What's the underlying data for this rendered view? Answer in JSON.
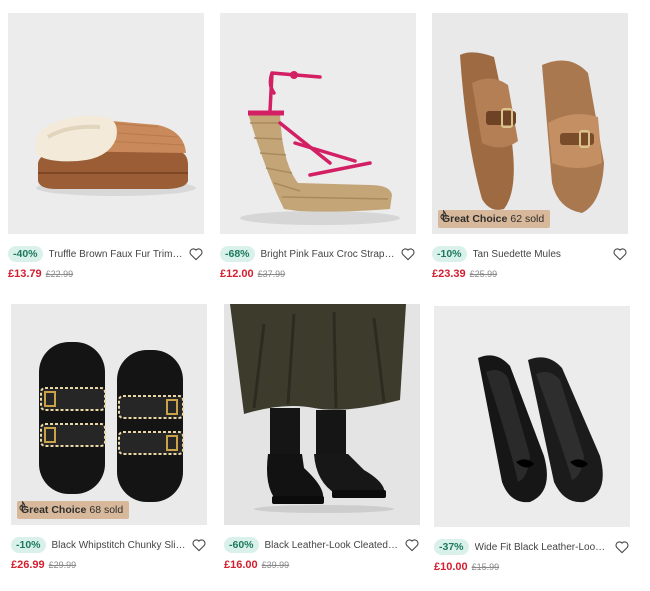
{
  "products": [
    {
      "discount": "-40%",
      "name": "Truffle Brown Faux Fur Trim Sli...",
      "price": "£13.79",
      "was": "£22.99",
      "image": "brown-faux-fur-slippers",
      "badge": null
    },
    {
      "discount": "-68%",
      "name": "Bright Pink Faux Croc Strappy...",
      "price": "£12.00",
      "was": "£37.99",
      "image": "pink-espadrille-wedge",
      "badge": null
    },
    {
      "discount": "-10%",
      "name": "Tan Suedette Mules",
      "price": "£23.39",
      "was": "£25.99",
      "image": "tan-suede-mules",
      "badge": {
        "label": "Great Choice",
        "sold": "62 sold"
      }
    },
    {
      "discount": "-10%",
      "name": "Black Whipstitch Chunky Sliders",
      "price": "£26.99",
      "was": "£29.99",
      "image": "black-whipstitch-sliders",
      "badge": {
        "label": "Great Choice",
        "sold": "68 sold"
      }
    },
    {
      "discount": "-60%",
      "name": "Black Leather-Look Cleated Bl...",
      "price": "£16.00",
      "was": "£39.99",
      "image": "black-chelsea-boots",
      "badge": null
    },
    {
      "discount": "-37%",
      "name": "Wide Fit Black Leather-Look B...",
      "price": "£10.00",
      "was": "£15.99",
      "image": "black-ballet-flats",
      "badge": null
    }
  ],
  "icons": {
    "wishlist": "heart-outline-icon",
    "badge": "flame-icon"
  },
  "colors": {
    "discount_bg": "#d9f1ea",
    "discount_text": "#1c7a5b",
    "price": "#d41f2f",
    "badge_bg": "#d8b89a"
  }
}
